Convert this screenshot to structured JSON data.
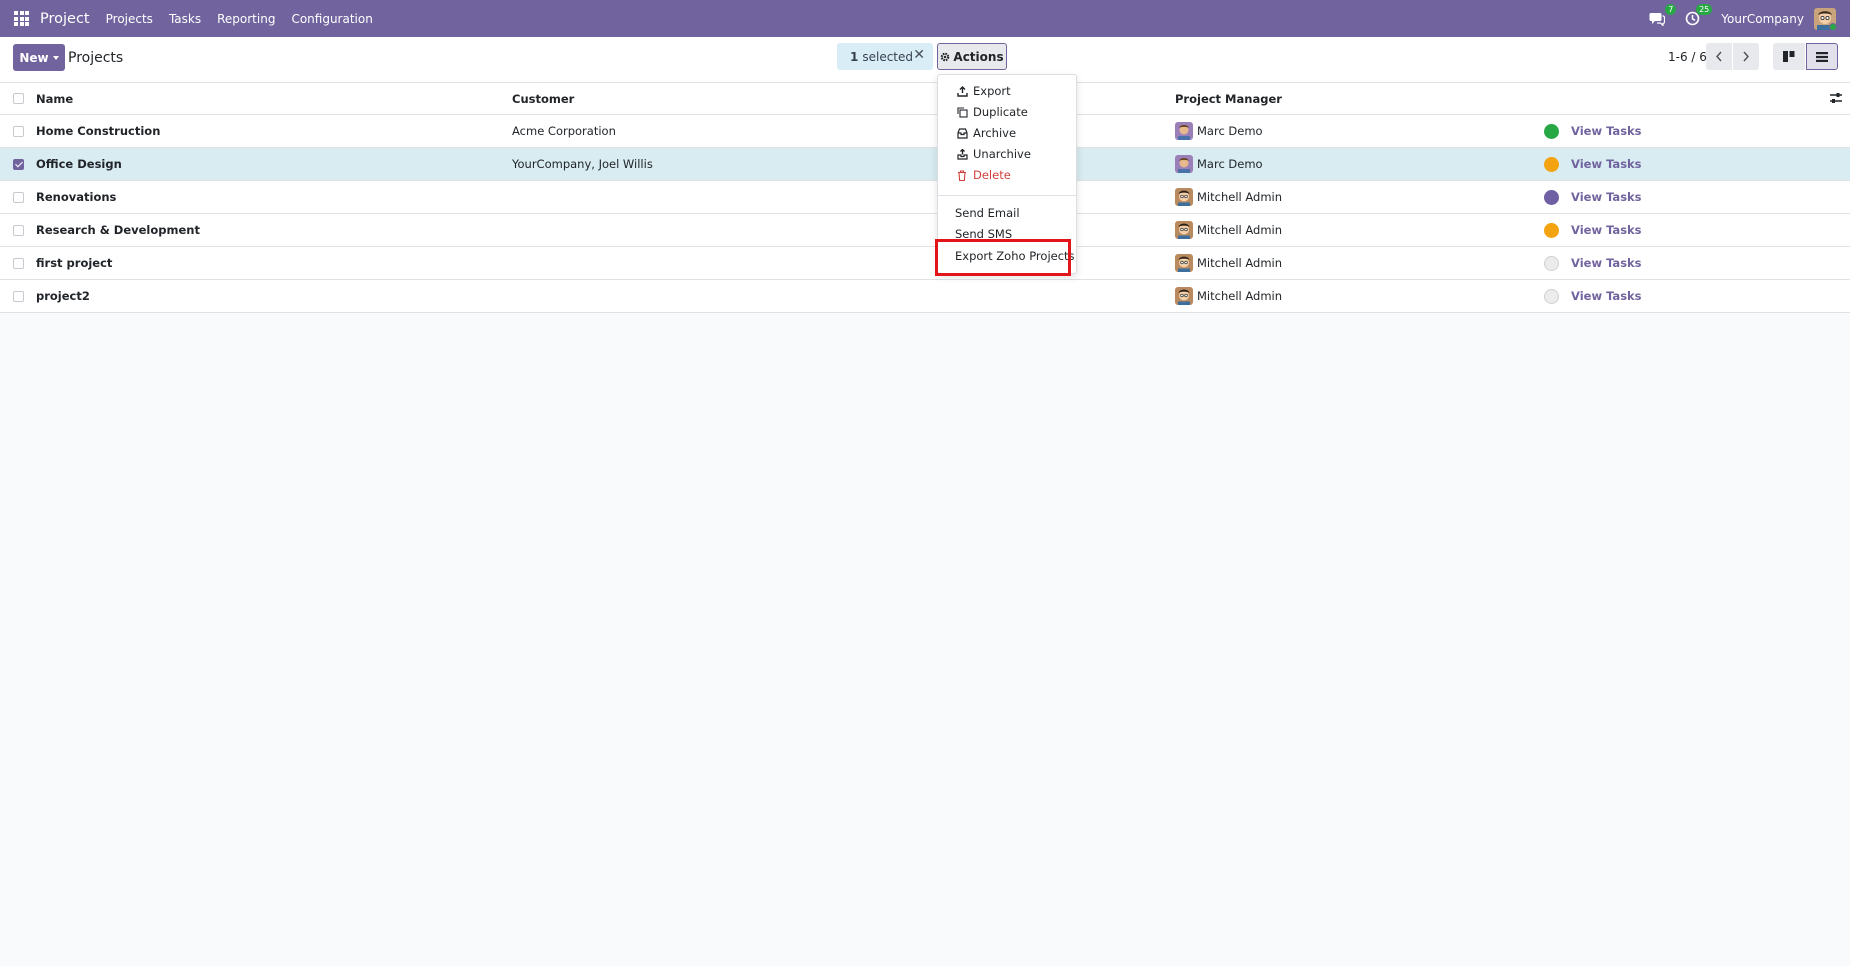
{
  "navbar": {
    "app_name": "Project",
    "menu": [
      "Projects",
      "Tasks",
      "Reporting",
      "Configuration"
    ],
    "messages_count": "7",
    "activities_count": "25",
    "company": "YourCompany",
    "bg_color": "#71639e"
  },
  "control": {
    "new_label": "New",
    "breadcrumb": "Projects",
    "selected_count": "1",
    "selected_label": "selected",
    "actions_label": "Actions",
    "pager": "1-6 / 6"
  },
  "table": {
    "headers": {
      "name": "Name",
      "customer": "Customer",
      "manager": "Project Manager"
    },
    "rows": [
      {
        "name": "Home Construction",
        "customer": "Acme Corporation",
        "manager": "Marc Demo",
        "color": "#28a745",
        "link": "View Tasks",
        "checked": false
      },
      {
        "name": "Office Design",
        "customer": "YourCompany, Joel Willis",
        "manager": "Marc Demo",
        "color": "#f3a30f",
        "link": "View Tasks",
        "checked": true
      },
      {
        "name": "Renovations",
        "customer": "",
        "manager": "Mitchell Admin",
        "color": "#6f5fa3",
        "link": "View Tasks",
        "checked": false
      },
      {
        "name": "Research & Development",
        "customer": "",
        "manager": "Mitchell Admin",
        "color": "#f3a30f",
        "link": "View Tasks",
        "checked": false
      },
      {
        "name": "first project",
        "customer": "",
        "manager": "Mitchell Admin",
        "color": "#ececec",
        "link": "View Tasks",
        "checked": false
      },
      {
        "name": "project2",
        "customer": "",
        "manager": "Mitchell Admin",
        "color": "#ececec",
        "link": "View Tasks",
        "checked": false
      }
    ]
  },
  "dropdown": {
    "items": [
      {
        "label": "Export",
        "icon": "upload-icon"
      },
      {
        "label": "Duplicate",
        "icon": "copy-icon"
      },
      {
        "label": "Archive",
        "icon": "archive-icon"
      },
      {
        "label": "Unarchive",
        "icon": "unarchive-icon"
      },
      {
        "label": "Delete",
        "icon": "trash-icon"
      }
    ],
    "extra": [
      "Send Email",
      "Send SMS",
      "Export Zoho Projects"
    ],
    "highlight_color": "#e2151b"
  }
}
